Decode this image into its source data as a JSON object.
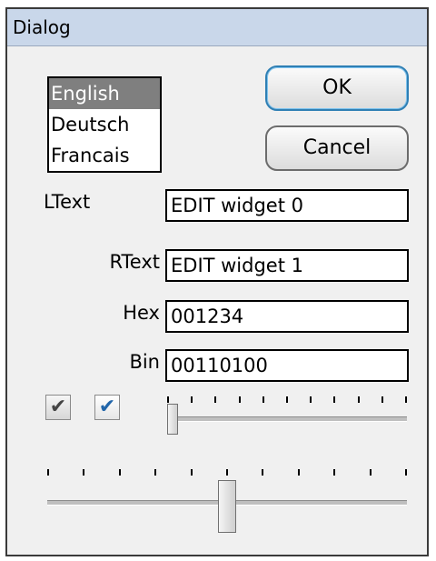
{
  "window": {
    "title": "Dialog"
  },
  "languages": {
    "items": [
      "English",
      "Deutsch",
      "Francais"
    ],
    "selected": "English"
  },
  "buttons": {
    "ok": "OK",
    "cancel": "Cancel"
  },
  "fields": {
    "ltext": {
      "label": "LText",
      "value": "EDIT widget 0"
    },
    "rtext": {
      "label": "RText",
      "value": "EDIT widget 1"
    },
    "hex": {
      "label": "Hex",
      "value": "001234"
    },
    "bin": {
      "label": "Bin",
      "value": "00110100"
    }
  },
  "checkboxes": [
    {
      "checked": true,
      "enabled": false
    },
    {
      "checked": true,
      "enabled": true
    }
  ],
  "sliders": {
    "slider1": {
      "min": 0,
      "max": 10,
      "value": 0
    },
    "slider2": {
      "min": 0,
      "max": 10,
      "value": 5
    }
  },
  "colors": {
    "title_bar": "#c9d7ea",
    "selection": "#7f7f7f",
    "check_enabled": "#2266aa",
    "check_disabled": "#444444"
  }
}
